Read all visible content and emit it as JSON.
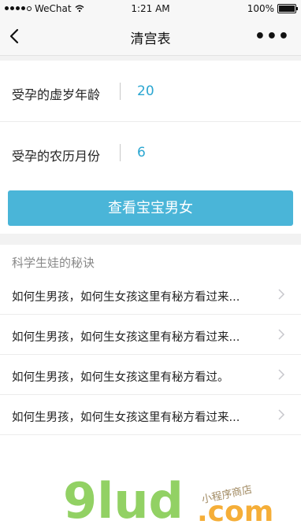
{
  "status": {
    "carrier": "WeChat",
    "time": "1:21 AM",
    "battery": "100%"
  },
  "nav": {
    "title": "清宫表"
  },
  "form": {
    "rows": [
      {
        "label": "受孕的虚岁年龄",
        "value": "20"
      },
      {
        "label": "受孕的农历月份",
        "value": "6"
      }
    ],
    "button_label": "查看宝宝男女"
  },
  "section": {
    "title": "科学生娃的秘诀",
    "items": [
      {
        "text": "如何生男孩，如何生女孩这里有秘方看过来..."
      },
      {
        "text": "如何生男孩，如何生女孩这里有秘方看过来..."
      },
      {
        "text": "如何生男孩，如何生女孩这里有秘方看过。"
      },
      {
        "text": "如何生男孩，如何生女孩这里有秘方看过来..."
      }
    ]
  },
  "watermark": {
    "brand": "9lud",
    "tld": ".com",
    "tagline": "小程序商店"
  },
  "colors": {
    "accent": "#4ab5d8",
    "value_text": "#2aa6d1",
    "watermark_green": "#7fc94a",
    "watermark_orange": "#f5a623"
  }
}
